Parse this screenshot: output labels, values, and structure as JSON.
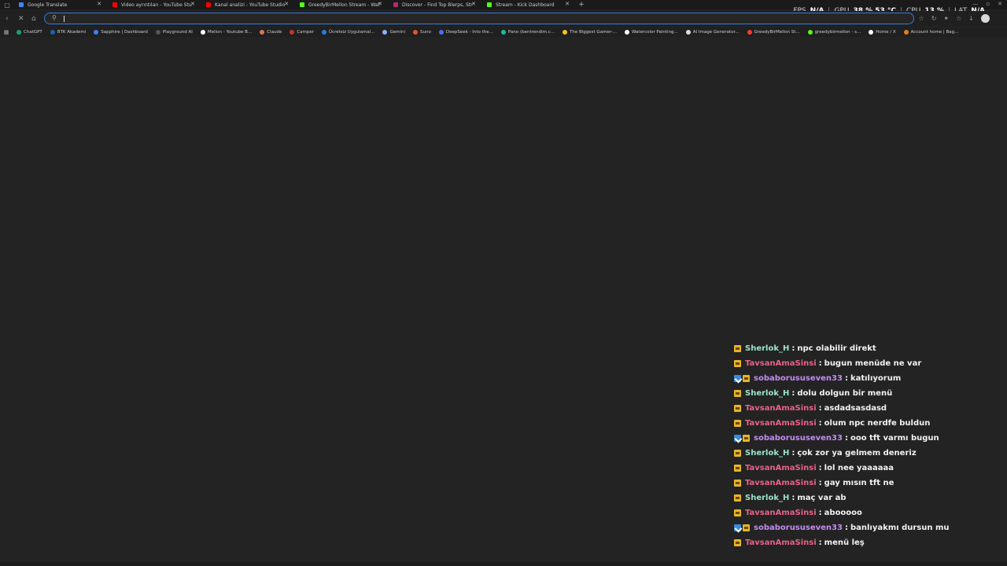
{
  "tabs": [
    {
      "label": "Google Translate",
      "color": "#4285f4"
    },
    {
      "label": "Video ayrıntıları - YouTube Studio",
      "color": "#ff0000"
    },
    {
      "label": "Kanal analizi - YouTube Studio",
      "color": "#ff0000"
    },
    {
      "label": "GreedyBirMellon Stream - Watch",
      "color": "#53fc18"
    },
    {
      "label": "Discover - Find Top Blerps, Stream",
      "color": "#b22b6a"
    },
    {
      "label": "Stream - Kick Dashboard",
      "color": "#53fc18"
    }
  ],
  "overlay_stats": [
    {
      "key": "FPS",
      "value": "N/A"
    },
    {
      "key": "GPU",
      "value": "38 % 53 °C"
    },
    {
      "key": "CPU",
      "value": "13 %"
    },
    {
      "key": "LAT",
      "value": "N/A"
    }
  ],
  "omnibox": {
    "value": "",
    "placeholder": ""
  },
  "bookmarks": [
    {
      "label": "ChatGPT",
      "color": "#10a37f"
    },
    {
      "label": "BTK Akademi",
      "color": "#1c5fb0"
    },
    {
      "label": "Sapphire | Dashboard",
      "color": "#3b82f6"
    },
    {
      "label": "Playground AI",
      "color": "#555555"
    },
    {
      "label": "Mellon - Youtube B...",
      "color": "#ffffff"
    },
    {
      "label": "Claude",
      "color": "#d97757"
    },
    {
      "label": "Camper",
      "color": "#c0392b"
    },
    {
      "label": "Ücretsiz Uygulamal...",
      "color": "#2a7de1"
    },
    {
      "label": "Gemini",
      "color": "#8ab4f8"
    },
    {
      "label": "Suno",
      "color": "#e8542d"
    },
    {
      "label": "DeepSeek - Into the...",
      "color": "#4d6bfe"
    },
    {
      "label": "Pano (bentrendim.c...",
      "color": "#1abc9c"
    },
    {
      "label": "The Biggest Gamer-...",
      "color": "#f5c518"
    },
    {
      "label": "Watercolor Painting...",
      "color": "#ffffff"
    },
    {
      "label": "AI Image Generator...",
      "color": "#dddddd"
    },
    {
      "label": "GreedyBirMellon St...",
      "color": "#ff3b30"
    },
    {
      "label": "greedybirmellon - s...",
      "color": "#53fc18"
    },
    {
      "label": "Home / X",
      "color": "#ffffff"
    },
    {
      "label": "Account home | Bag...",
      "color": "#e67e22"
    }
  ],
  "chat": {
    "messages": [
      {
        "user": "Sherlok_H",
        "color": "#9de3c9",
        "badges": [
          "sub"
        ],
        "text": "npc olabilir direkt"
      },
      {
        "user": "TavsanAmaSinsi",
        "color": "#e8628a",
        "badges": [
          "sub"
        ],
        "text": "bugun menüde ne var"
      },
      {
        "user": "sobaborususeven33",
        "color": "#c38cf0",
        "badges": [
          "mod",
          "sub"
        ],
        "text": "katılıyorum"
      },
      {
        "user": "Sherlok_H",
        "color": "#9de3c9",
        "badges": [
          "sub"
        ],
        "text": "dolu dolgun bir menü"
      },
      {
        "user": "TavsanAmaSinsi",
        "color": "#e8628a",
        "badges": [
          "sub"
        ],
        "text": "asdadsasdasd"
      },
      {
        "user": "TavsanAmaSinsi",
        "color": "#e8628a",
        "badges": [
          "sub"
        ],
        "text": "olum npc nerdfe buldun"
      },
      {
        "user": "sobaborususeven33",
        "color": "#c38cf0",
        "badges": [
          "mod",
          "sub"
        ],
        "text": "ooo tft varmı bugun"
      },
      {
        "user": "Sherlok_H",
        "color": "#9de3c9",
        "badges": [
          "sub"
        ],
        "text": "çok zor ya gelmem deneriz"
      },
      {
        "user": "TavsanAmaSinsi",
        "color": "#e8628a",
        "badges": [
          "sub"
        ],
        "text": "lol nee yaaaaaa"
      },
      {
        "user": "TavsanAmaSinsi",
        "color": "#e8628a",
        "badges": [
          "sub"
        ],
        "text": "gay mısın tft ne"
      },
      {
        "user": "Sherlok_H",
        "color": "#9de3c9",
        "badges": [
          "sub"
        ],
        "text": "maç var ab"
      },
      {
        "user": "TavsanAmaSinsi",
        "color": "#e8628a",
        "badges": [
          "sub"
        ],
        "text": "abooooo"
      },
      {
        "user": "sobaborususeven33",
        "color": "#c38cf0",
        "badges": [
          "mod",
          "sub"
        ],
        "text": "banlıyakmı dursun mu"
      },
      {
        "user": "TavsanAmaSinsi",
        "color": "#e8628a",
        "badges": [
          "sub"
        ],
        "text": "menü leş"
      }
    ]
  }
}
